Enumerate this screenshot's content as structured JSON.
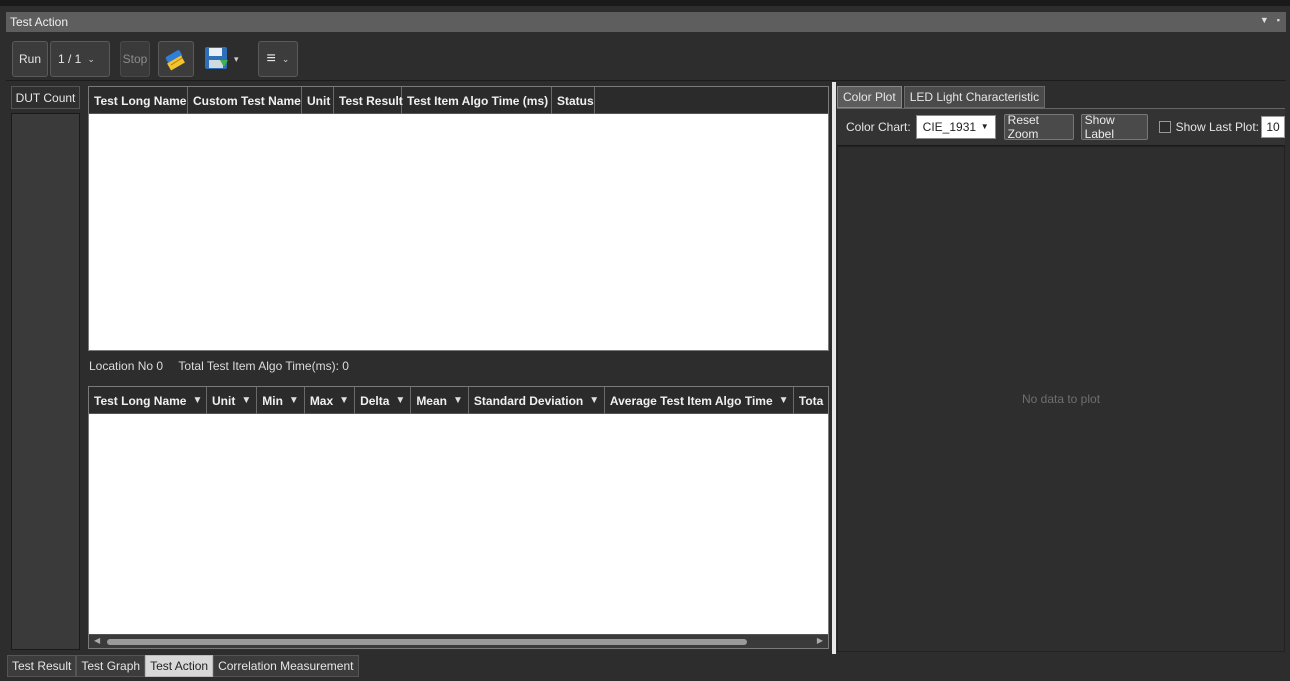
{
  "window": {
    "title": "Test Action"
  },
  "toolbar": {
    "run_label": "Run",
    "page_selector_value": "1 / 1",
    "stop_label": "Stop",
    "clear_icon": "broom-icon",
    "save_icon": "save-disk-icon",
    "menu_icon": "hamburger-menu-icon"
  },
  "dut": {
    "header": "DUT Count"
  },
  "results_grid": {
    "columns": [
      "Test Long Name",
      "Custom Test Name",
      "Unit",
      "Test Result",
      "Test Item Algo Time (ms)",
      "Status"
    ]
  },
  "info": {
    "location": "Location No 0",
    "total_time": "Total Test Item Algo Time(ms): 0"
  },
  "stats_grid": {
    "columns": [
      "Test Long Name",
      "Unit",
      "Min",
      "Max",
      "Delta",
      "Mean",
      "Standard Deviation",
      "Average Test Item Algo Time",
      "Tota"
    ]
  },
  "right_panel": {
    "tabs": [
      "Color Plot",
      "LED Light Characteristic"
    ],
    "color_chart_label": "Color Chart:",
    "color_chart_value": "CIE_1931",
    "reset_zoom_label": "Reset Zoom",
    "show_label_label": "Show Label",
    "show_last_plot_label": "Show Last Plot:",
    "show_last_plot_value": "10",
    "empty_message": "No data to plot"
  },
  "bottom_tabs": [
    "Test Result",
    "Test Graph",
    "Test Action",
    "Correlation Measurement"
  ],
  "colors": {
    "background": "#2d2d2d",
    "titlebar": "#5e5e5e",
    "grid_body": "#ffffff"
  }
}
